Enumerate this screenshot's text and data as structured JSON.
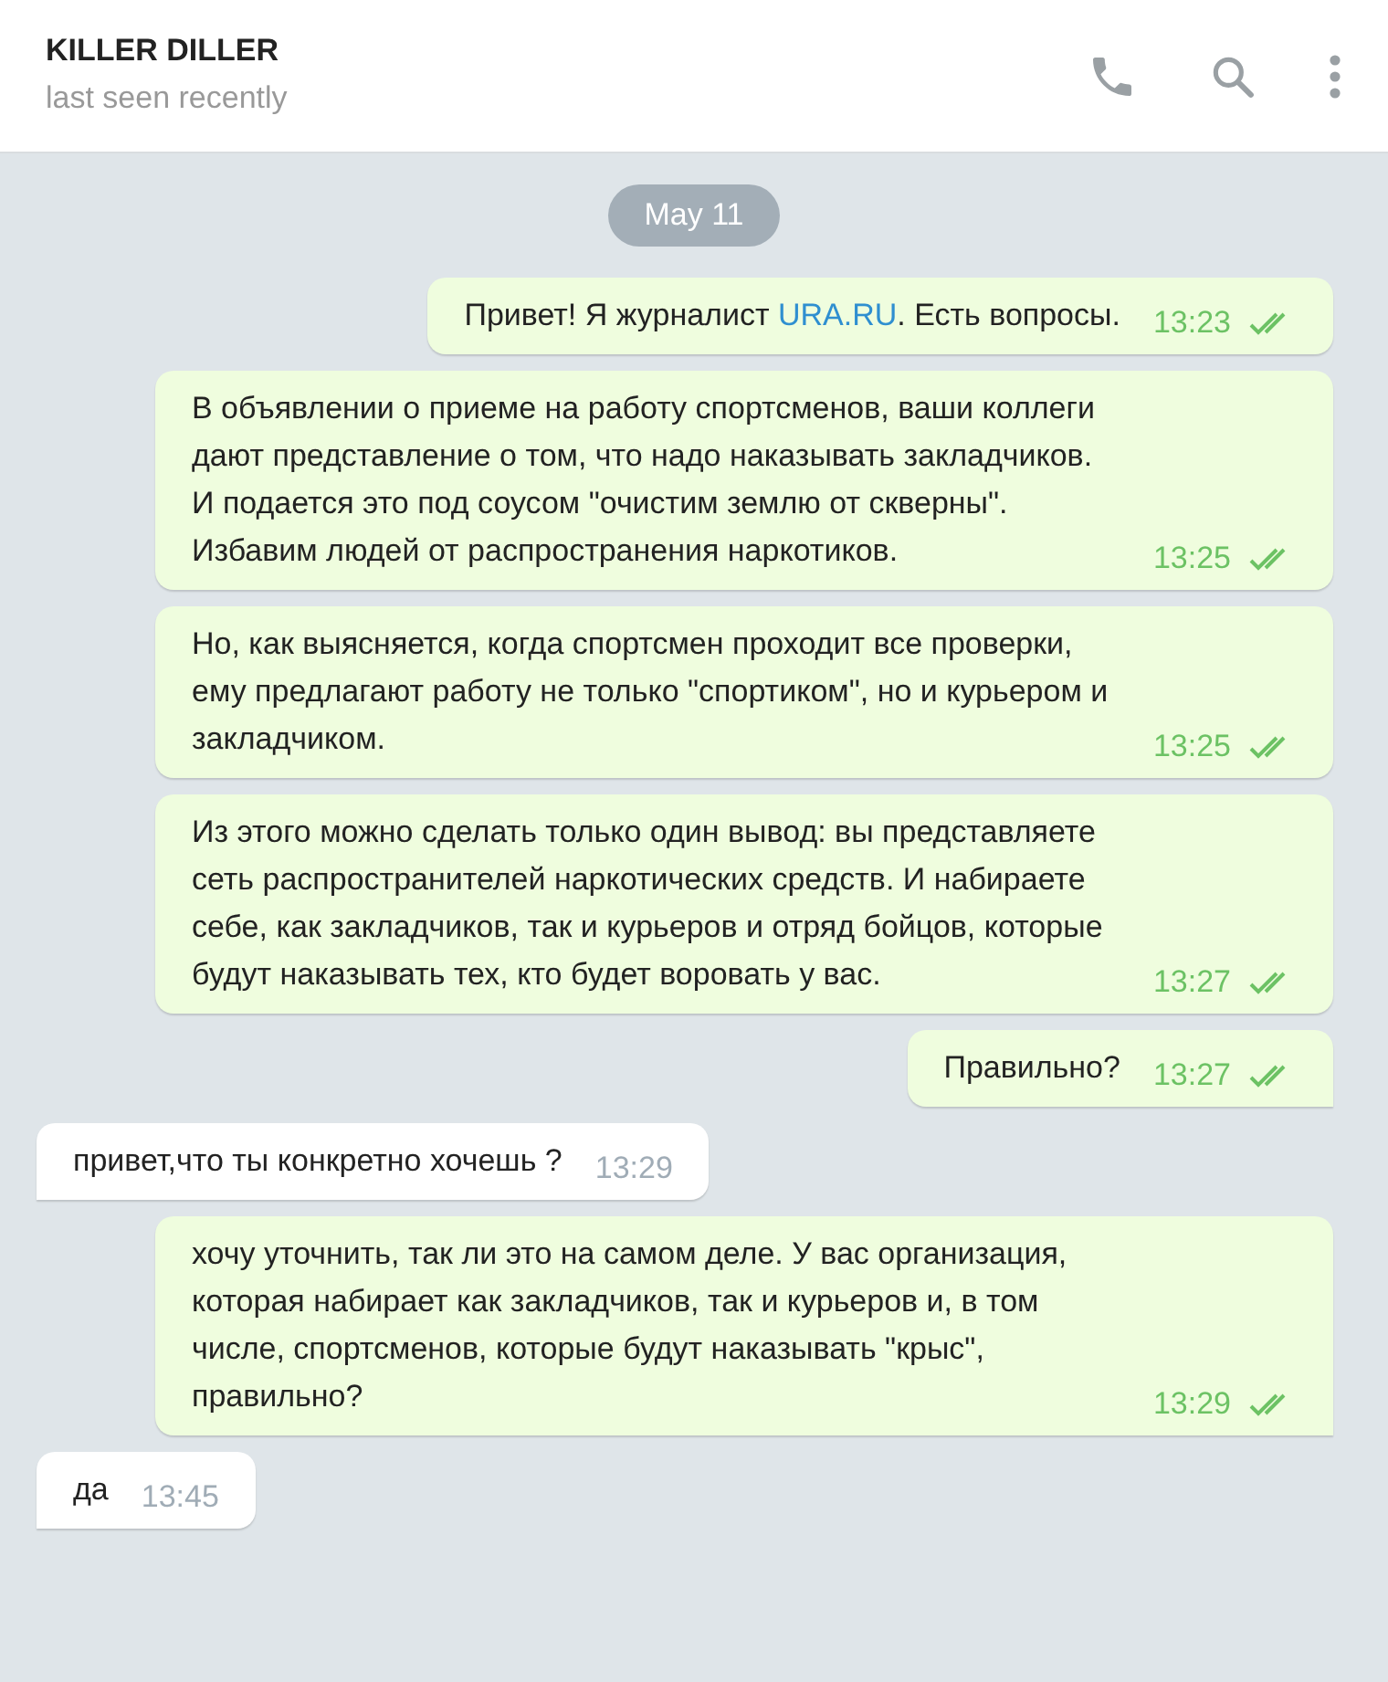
{
  "header": {
    "title": "KILLER DILLER",
    "status": "last seen recently"
  },
  "date_badge": "May 11",
  "messages": [
    {
      "kind": "outgoing",
      "parts": [
        {
          "kind": "text",
          "text": "Привет! Я журналист "
        },
        {
          "kind": "link",
          "text": "URA.RU"
        },
        {
          "kind": "text",
          "text": ". Есть вопросы."
        }
      ],
      "time": "13:23",
      "read": true,
      "tail": false
    },
    {
      "kind": "outgoing",
      "parts": [
        {
          "kind": "text",
          "text": "В объявлении о приеме на работу спортсменов, ваши коллеги дают представление о том, что надо наказывать закладчиков. И подается это под соусом \"очистим землю от скверны\". Избавим людей от распространения наркотиков."
        }
      ],
      "time": "13:25",
      "read": true,
      "tail": false
    },
    {
      "kind": "outgoing",
      "parts": [
        {
          "kind": "text",
          "text": "Но, как выясняется, когда спортсмен проходит все проверки, ему предлагают работу не только \"спортиком\", но и курьером и закладчиком."
        }
      ],
      "time": "13:25",
      "read": true,
      "tail": false
    },
    {
      "kind": "outgoing",
      "parts": [
        {
          "kind": "text",
          "text": "Из этого можно сделать только один вывод: вы представляете сеть распространителей наркотических средств. И набираете себе, как закладчиков, так и курьеров и отряд бойцов, которые будут наказывать тех, кто будет воровать у вас."
        }
      ],
      "time": "13:27",
      "read": true,
      "tail": false
    },
    {
      "kind": "outgoing",
      "parts": [
        {
          "kind": "text",
          "text": "Правильно?"
        }
      ],
      "time": "13:27",
      "read": true,
      "tail": true
    },
    {
      "kind": "incoming",
      "parts": [
        {
          "kind": "text",
          "text": "привет,что ты конкретно хочешь ?"
        }
      ],
      "time": "13:29",
      "tail": true
    },
    {
      "kind": "outgoing",
      "parts": [
        {
          "kind": "text",
          "text": "хочу уточнить, так ли это на самом деле. У вас организация, которая набирает как закладчиков, так и курьеров и, в том числе, спортсменов, которые будут наказывать \"крыс\", правильно?"
        }
      ],
      "time": "13:29",
      "read": true,
      "tail": true
    },
    {
      "kind": "incoming",
      "parts": [
        {
          "kind": "text",
          "text": "да"
        }
      ],
      "time": "13:45",
      "tail": true
    }
  ]
}
